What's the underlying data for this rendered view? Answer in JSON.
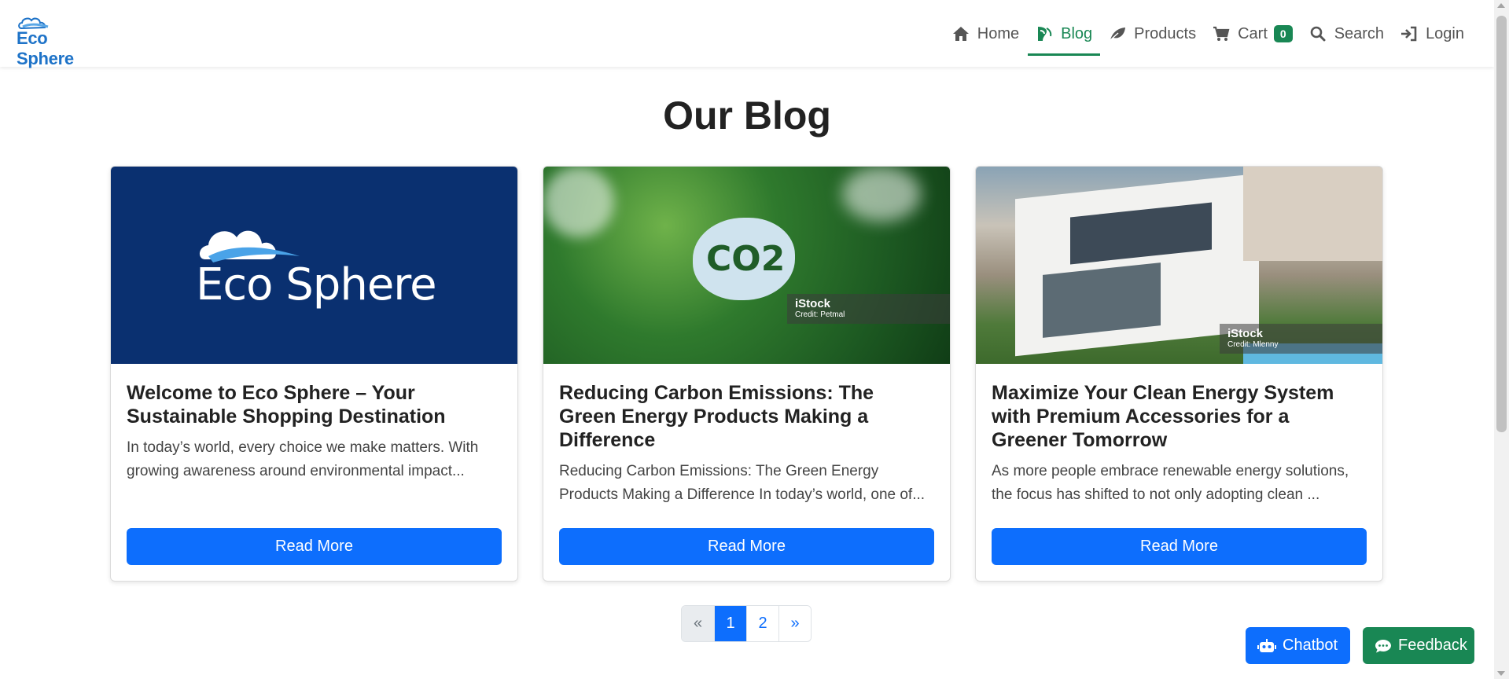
{
  "brand": {
    "name": "Eco Sphere"
  },
  "nav": {
    "items": [
      {
        "label": "Home",
        "icon": "home-icon"
      },
      {
        "label": "Blog",
        "icon": "blog-icon",
        "active": true
      },
      {
        "label": "Products",
        "icon": "leaf-icon"
      },
      {
        "label": "Cart",
        "icon": "cart-icon",
        "badge": "0"
      },
      {
        "label": "Search",
        "icon": "search-icon"
      },
      {
        "label": "Login",
        "icon": "login-icon"
      }
    ]
  },
  "page": {
    "title": "Our Blog"
  },
  "posts": [
    {
      "title": "Welcome to Eco Sphere – Your Sustainable Shopping Destination",
      "excerpt": "In today’s world, every choice we make matters. With growing awareness around environmental impact...",
      "image_logo_text": "Eco Sphere",
      "button": "Read More"
    },
    {
      "title": "Reducing Carbon Emissions: The Green Energy Products Making a Difference",
      "excerpt": "Reducing Carbon Emissions: The Green Energy Products Making a Difference In today’s world, one of...",
      "image_text": "CO2",
      "credit_brand": "iStock",
      "credit_text": "Credit: Petmal",
      "button": "Read More"
    },
    {
      "title": "Maximize Your Clean Energy System with Premium Accessories for a Greener Tomorrow",
      "excerpt": "As more people embrace renewable energy solutions, the focus has shifted to not only adopting clean ...",
      "credit_brand": "iStock",
      "credit_text": "Credit: Mlenny",
      "button": "Read More"
    }
  ],
  "pagination": {
    "prev": "«",
    "pages": [
      "1",
      "2"
    ],
    "current": "1",
    "next": "»"
  },
  "floating": {
    "chatbot": "Chatbot",
    "feedback": "Feedback"
  },
  "colors": {
    "primary": "#0d6efd",
    "success": "#198754",
    "brand_blue": "#1e73c8",
    "logo_bg": "#0a3070"
  }
}
